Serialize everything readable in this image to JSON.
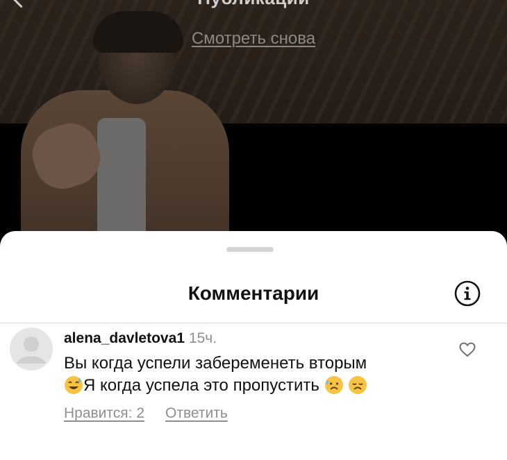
{
  "header": {
    "title": "Публикации"
  },
  "video": {
    "watch_again": "Смотреть снова"
  },
  "comments_sheet": {
    "title": "Комментарии",
    "info_icon": "info-icon",
    "comments": [
      {
        "username": "alena_davletova1",
        "time": "15ч.",
        "text_line1": "Вы когда успели забеременеть вторым",
        "text_line2": "Я когда успела это пропустить",
        "likes_label": "Нравится: 2",
        "reply_label": "Ответить",
        "like_icon": "heart-icon"
      }
    ]
  },
  "colors": {
    "sheet_bg": "#ffffff",
    "secondary_text": "#8e8e8e",
    "primary_text": "#111111"
  }
}
